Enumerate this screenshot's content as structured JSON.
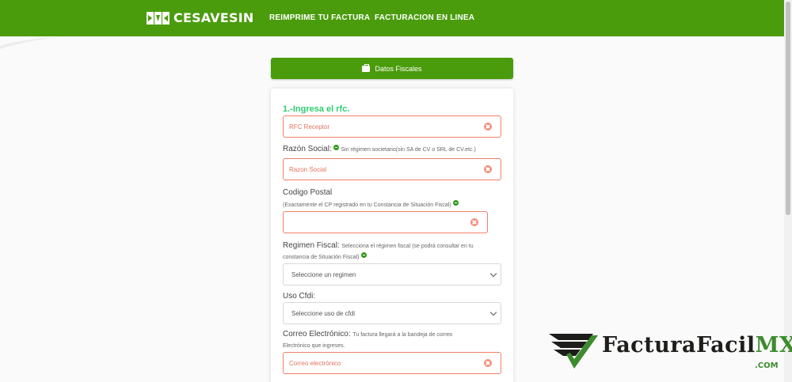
{
  "nav": {
    "brand": "CESAVESIN",
    "links": [
      "REIMPRIME TU FACTURA",
      "FACTURACION EN LINEA"
    ]
  },
  "form": {
    "header_button": "Datos Fiscales",
    "step_title": "1.-Ingresa el rfc.",
    "rfc": {
      "placeholder": "RFC Receptor"
    },
    "razon": {
      "label": "Razón Social:",
      "hint": "Sin régimen societario(sin SA de CV o SRL de CV.etc.)",
      "placeholder": "Razon Social"
    },
    "cp": {
      "label": "Codigo Postal",
      "hint": "(Exactamente el CP registrado en tu Constancia de Situación Fiscal)",
      "placeholder": ""
    },
    "regimen": {
      "label": "Regimen Fiscal:",
      "hint_line1": "Selecciona el régimen fiscal (se podrá consultar en tu",
      "hint_line2": "constancia de Situación Fiscal)",
      "selected": "Seleccione un regimen"
    },
    "uso": {
      "label": "Uso Cfdi:",
      "selected": "Seleccione uso de cfdi"
    },
    "correo": {
      "label": "Correo Electrónico:",
      "hint_line1": "Tu factura llegará a la bandeja de correo",
      "hint_line2": "Electrónico que ingreses.",
      "placeholder": "Correo electrónico"
    }
  },
  "watermark": {
    "brand_main": "FacturaFacil",
    "brand_mx": "MX",
    "brand_com": ".COM"
  },
  "colors": {
    "primary_green": "#4a9c0c",
    "accent_green": "#2ecc71",
    "error": "#f1806a"
  },
  "icons": [
    "cesavesin-logo-icon",
    "briefcase-icon",
    "info-icon",
    "error-icon",
    "chevron-down-icon",
    "facturafacil-logo-icon"
  ]
}
